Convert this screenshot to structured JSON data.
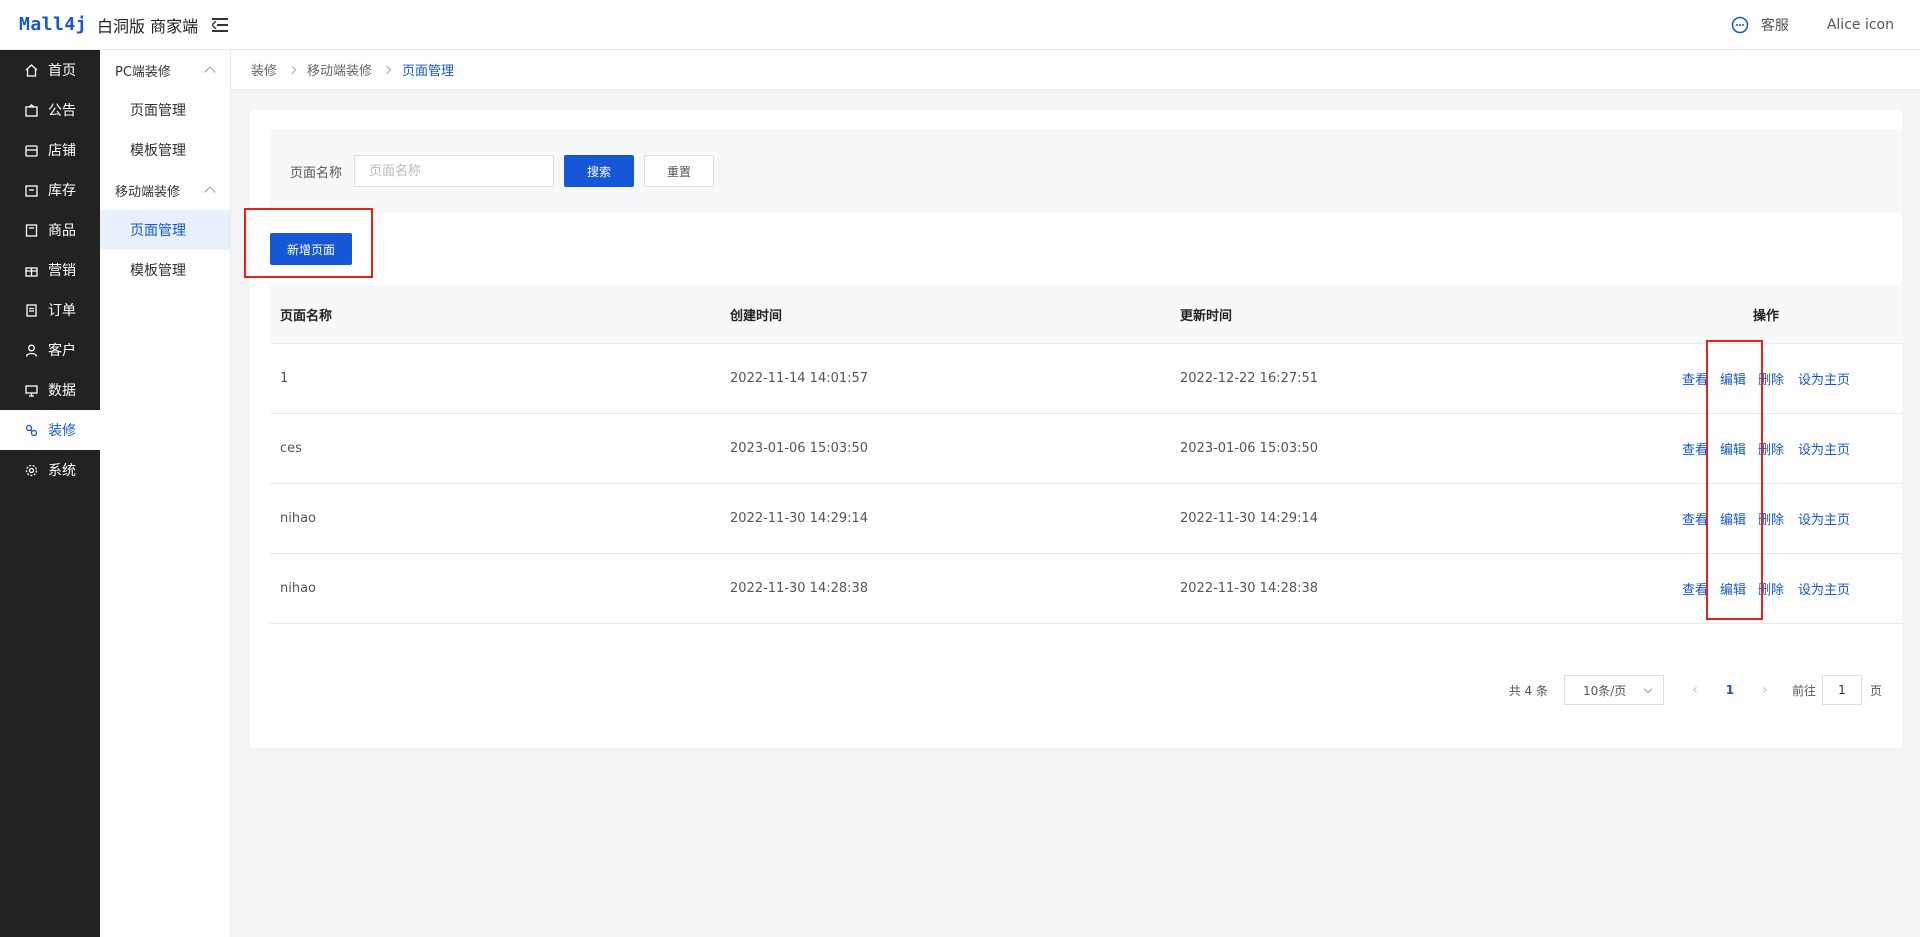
{
  "header": {
    "logo_mark": "Mall4j",
    "logo_sub": "白洞版 商家端",
    "service_label": "客服",
    "user_name": "Alice icon"
  },
  "sidebar": {
    "items": [
      {
        "label": "首页",
        "icon": "home-icon"
      },
      {
        "label": "公告",
        "icon": "notice-icon"
      },
      {
        "label": "店铺",
        "icon": "shop-icon"
      },
      {
        "label": "库存",
        "icon": "stock-icon"
      },
      {
        "label": "商品",
        "icon": "product-icon"
      },
      {
        "label": "营销",
        "icon": "gift-icon"
      },
      {
        "label": "订单",
        "icon": "order-icon"
      },
      {
        "label": "客户",
        "icon": "user-icon"
      },
      {
        "label": "数据",
        "icon": "data-icon"
      },
      {
        "label": "装修",
        "icon": "decorate-icon"
      },
      {
        "label": "系统",
        "icon": "settings-icon"
      }
    ],
    "active_index": 9
  },
  "subnav": {
    "group1": "PC端装修",
    "group1_items": [
      "页面管理",
      "模板管理"
    ],
    "group2": "移动端装修",
    "group2_items": [
      "页面管理",
      "模板管理"
    ]
  },
  "breadcrumb": [
    "装修",
    "移动端装修",
    "页面管理"
  ],
  "search": {
    "label": "页面名称",
    "placeholder": "页面名称",
    "search_btn": "搜索",
    "reset_btn": "重置"
  },
  "add_btn": "新增页面",
  "table": {
    "headers": [
      "页面名称",
      "创建时间",
      "更新时间",
      "操作"
    ],
    "rows": [
      {
        "name": "1",
        "created": "2022-11-14 14:01:57",
        "updated": "2022-12-22 16:27:51"
      },
      {
        "name": "ces",
        "created": "2023-01-06 15:03:50",
        "updated": "2023-01-06 15:03:50"
      },
      {
        "name": "nihao",
        "created": "2022-11-30 14:29:14",
        "updated": "2022-11-30 14:29:14"
      },
      {
        "name": "nihao",
        "created": "2022-11-30 14:28:38",
        "updated": "2022-11-30 14:28:38"
      }
    ],
    "ops": [
      "查看",
      "编辑",
      "删除",
      "设为主页"
    ]
  },
  "pager": {
    "total": "共 4 条",
    "page_size": "10条/页",
    "current": "1",
    "goto_label": "前往",
    "goto_value": "1",
    "page_suffix": "页"
  }
}
